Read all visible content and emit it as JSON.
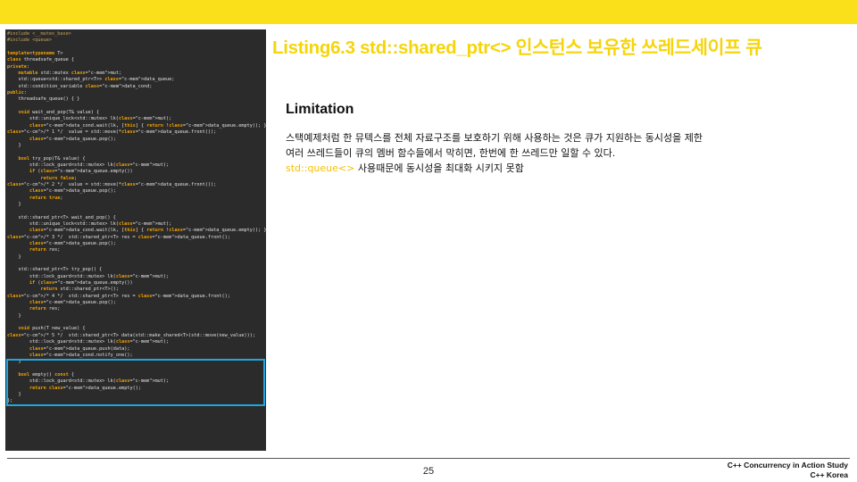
{
  "slide": {
    "title": "Listing6.3 std::shared_ptr<> 인스턴스 보유한  쓰레드세이프 큐",
    "heading": "Limitation",
    "paragraph_line1": "스택예제처럼 한 뮤텍스를 전체 자료구조를 보호하기 위해 사용하는 것은 큐가 지원하는 동시성을 제한",
    "paragraph_line2": "여러 쓰레드들이 큐의 멤버 함수들에서 막히면, 한번에 한 쓰레드만 일할 수 있다.",
    "paragraph_line3_accent": "std::queue<>",
    "paragraph_line3_rest": " 사용때문에 동시성을 최대화 시키지 못함",
    "page_number": "25",
    "footer_line1": "C++ Concurrency in Action Study",
    "footer_line2": "C++ Korea"
  },
  "colors": {
    "top_bar": "#f9e01b",
    "title": "#f5d50a",
    "accent": "#f5c000",
    "code_bg": "#2b2b2b",
    "highlight_border": "#1ea7e0"
  },
  "code_lines": [
    "#include <__mutex_base>",
    "#include <queue>",
    "",
    "template<typename T>",
    "class threadsafe_queue {",
    "private:",
    "    mutable std::mutex mut;",
    "    std::queue<std::shared_ptr<T>> data_queue;",
    "    std::condition_variable data_cond;",
    "public:",
    "    threadsafe_queue() { }",
    "",
    "    void wait_and_pop(T& value) {",
    "        std::unique_lock<std::mutex> lk(mut);",
    "        data_cond.wait(lk, [this] { return !data_queue.empty(); });",
    "/* 1 */  value = std::move(*data_queue.front());",
    "        data_queue.pop();",
    "    }",
    "",
    "    bool try_pop(T& value) {",
    "        std::lock_guard<std::mutex> lk(mut);",
    "        if (data_queue.empty())",
    "            return false;",
    "/* 2 */  value = std::move(*data_queue.front());",
    "        data_queue.pop();",
    "        return true;",
    "    }",
    "",
    "    std::shared_ptr<T> wait_and_pop() {",
    "        std::unique_lock<std::mutex> lk(mut);",
    "        data_cond.wait(lk, [this] { return !data_queue.empty(); });",
    "/* 3 */  std::shared_ptr<T> res = data_queue.front();",
    "        data_queue.pop();",
    "        return res;",
    "    }",
    "",
    "    std::shared_ptr<T> try_pop() {",
    "        std::lock_guard<std::mutex> lk(mut);",
    "        if (data_queue.empty())",
    "            return std::shared_ptr<T>();",
    "/* 4 */  std::shared_ptr<T> res = data_queue.front();",
    "        data_queue.pop();",
    "        return res;",
    "    }",
    "",
    "    void push(T new_value) {",
    "/* 5 */  std::shared_ptr<T> data(std::make_shared<T>(std::move(new_value)));",
    "        std::lock_guard<std::mutex> lk(mut);",
    "        data_queue.push(data);",
    "        data_cond.notify_one();",
    "    }",
    "",
    "    bool empty() const {",
    "        std::lock_guard<std::mutex> lk(mut);",
    "        return data_queue.empty();",
    "    }",
    "};"
  ]
}
